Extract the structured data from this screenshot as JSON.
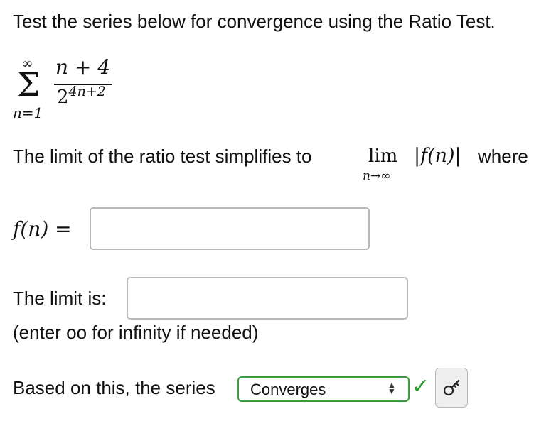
{
  "question": {
    "prompt": "Test the series below for convergence using the Ratio Test."
  },
  "series": {
    "sum_upper": "∞",
    "sum_lower": "n=1",
    "sigma": "Σ",
    "numerator": "n + 4",
    "denominator_base": "2",
    "denominator_exponent": "4n+2"
  },
  "ratio_test": {
    "text": "The limit of the ratio test simplifies to",
    "lim": "lim",
    "lim_sub": "n→∞",
    "expr": "|f(n)|",
    "where": "where"
  },
  "fn_row": {
    "label": "f(n) =",
    "value": "",
    "placeholder": ""
  },
  "limit_row": {
    "label": "The limit is:",
    "value": "",
    "hint": "(enter oo for infinity if needed)"
  },
  "conclusion": {
    "label": "Based on this, the series",
    "selected": "Converges",
    "updown_icon": "select-arrows-icon",
    "status_icon": "check-icon",
    "status_color": "#2e9a2e",
    "key_icon": "key-icon"
  }
}
